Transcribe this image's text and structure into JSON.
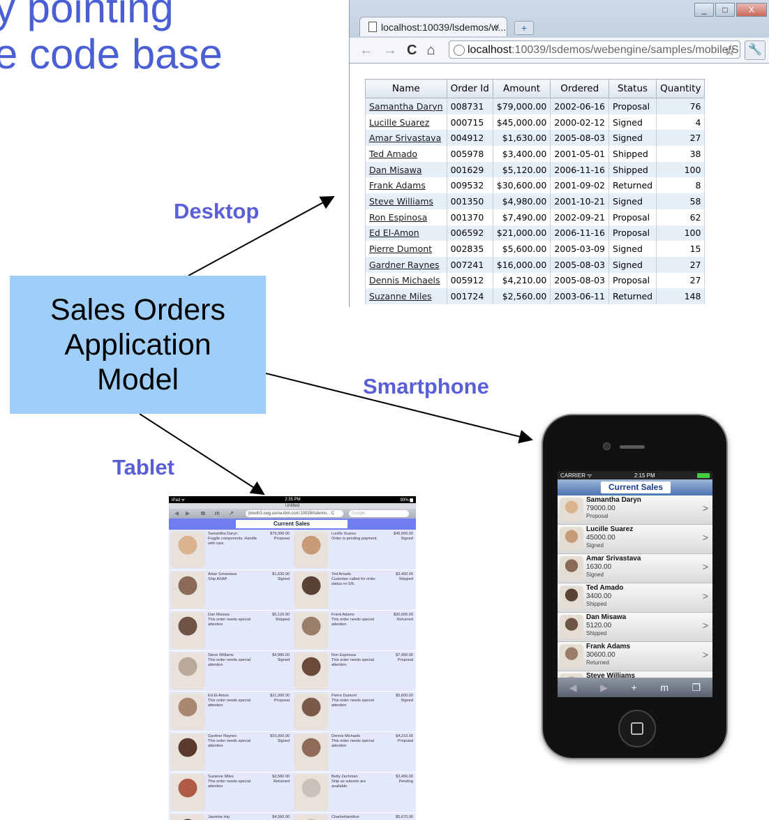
{
  "slide": {
    "title_lines": [
      "y pointing",
      "e code base"
    ],
    "center_box_lines": [
      "Sales Orders",
      "Application",
      "Model"
    ],
    "labels": {
      "desktop": "Desktop",
      "smartphone": "Smartphone",
      "tablet": "Tablet"
    }
  },
  "desktop_browser": {
    "tab_title": "localhost:10039/lsdemos/w...",
    "tab_close": "×",
    "new_tab": "+",
    "window_buttons": [
      "_",
      "□",
      "X"
    ],
    "nav": {
      "back": "←",
      "forward": "→",
      "reload": "C",
      "home": "⌂"
    },
    "url_host": "localhost",
    "url_rest": ":10039/lsdemos/webengine/samples/mobile/S:",
    "star": "☆",
    "wrench": "🔧",
    "table": {
      "columns": [
        "Name",
        "Order Id",
        "Amount",
        "Ordered",
        "Status",
        "Quantity"
      ],
      "rows": [
        [
          "Samantha Daryn",
          "008731",
          "$79,000.00",
          "2002-06-16",
          "Proposal",
          "76"
        ],
        [
          "Lucille Suarez",
          "000715",
          "$45,000.00",
          "2000-02-12",
          "Signed",
          "4"
        ],
        [
          "Amar Srivastava",
          "004912",
          "$1,630.00",
          "2005-08-03",
          "Signed",
          "27"
        ],
        [
          "Ted Amado",
          "005978",
          "$3,400.00",
          "2001-05-01",
          "Shipped",
          "38"
        ],
        [
          "Dan Misawa",
          "001629",
          "$5,120.00",
          "2006-11-16",
          "Shipped",
          "100"
        ],
        [
          "Frank Adams",
          "009532",
          "$30,600.00",
          "2001-09-02",
          "Returned",
          "8"
        ],
        [
          "Steve Williams",
          "001350",
          "$4,980.00",
          "2001-10-21",
          "Signed",
          "58"
        ],
        [
          "Ron Espinosa",
          "001370",
          "$7,490.00",
          "2002-09-21",
          "Proposal",
          "62"
        ],
        [
          "Ed El-Amon",
          "006592",
          "$21,000.00",
          "2006-11-16",
          "Proposal",
          "100"
        ],
        [
          "Pierre Dumont",
          "002835",
          "$5,600.00",
          "2005-03-09",
          "Signed",
          "15"
        ],
        [
          "Gardner Raynes",
          "007241",
          "$16,000.00",
          "2005-08-03",
          "Signed",
          "27"
        ],
        [
          "Dennis Michaels",
          "005912",
          "$4,210.00",
          "2005-08-03",
          "Proposal",
          "27"
        ],
        [
          "Suzanne Miles",
          "001724",
          "$2,560.00",
          "2003-06-11",
          "Returned",
          "148"
        ]
      ]
    }
  },
  "tablet": {
    "status_left": "iPad ᯤ",
    "status_time": "2:35 PM",
    "status_right": "93% ▆",
    "page_title": "Untitled",
    "url": "jbooth3.swg.usma.ibm.com:10039/lsdemo... C",
    "search_placeholder": "Google",
    "header": "Current Sales",
    "cards": [
      {
        "name": "Samantha Daryn",
        "note": "Fragile components. Handle with care.",
        "amount": "$79,000.00",
        "status": "Proposal",
        "color": "#d9b48f"
      },
      {
        "name": "Lucille Suarez",
        "note": "Order is pending payment.",
        "amount": "$45,000.00",
        "status": "Signed",
        "color": "#c99a78"
      },
      {
        "name": "Amar Srivastava",
        "note": "Ship ASAP.",
        "amount": "$1,630.00",
        "status": "Signed",
        "color": "#8a6a58"
      },
      {
        "name": "Ted Amado",
        "note": "Customer called for order status on 5/6.",
        "amount": "$3,400.00",
        "status": "Shipped",
        "color": "#5a4336"
      },
      {
        "name": "Dan Misawa",
        "note": "This order needs special attention",
        "amount": "$5,120.00",
        "status": "Shipped",
        "color": "#6e5546"
      },
      {
        "name": "Frank Adams",
        "note": "This order needs special attention",
        "amount": "$30,600.00",
        "status": "Returned",
        "color": "#9a7e6a"
      },
      {
        "name": "Steve Williams",
        "note": "This order needs special attention",
        "amount": "$4,980.00",
        "status": "Signed",
        "color": "#b9a99a"
      },
      {
        "name": "Ron Espinosa",
        "note": "This order needs special attention",
        "amount": "$7,490.00",
        "status": "Proposal",
        "color": "#6a4a38"
      },
      {
        "name": "Ed El-Amon",
        "note": "This order needs special attention",
        "amount": "$21,000.00",
        "status": "Proposal",
        "color": "#a98872"
      },
      {
        "name": "Pierre Dumont",
        "note": "This order needs special attention",
        "amount": "$5,600.00",
        "status": "Signed",
        "color": "#7a5a48"
      },
      {
        "name": "Gardner Raynes",
        "note": "This order needs special attention",
        "amount": "$16,000.00",
        "status": "Signed",
        "color": "#5a3a2c"
      },
      {
        "name": "Dennis Michaels",
        "note": "This order needs special attention",
        "amount": "$4,210.00",
        "status": "Proposal",
        "color": "#8e6c58"
      },
      {
        "name": "Suzanne Miles",
        "note": "This order needs special attention",
        "amount": "$2,560.00",
        "status": "Returned",
        "color": "#b05a48"
      },
      {
        "name": "Betty Zechman",
        "note": "Ship as subsets are available.",
        "amount": "$3,456.00",
        "status": "Pending",
        "color": "#c9c2b8"
      },
      {
        "name": "Jasmine Haj",
        "note": "",
        "amount": "$4,560.00",
        "status": "",
        "color": "#3a2a22"
      },
      {
        "name": "CharlieHamilton",
        "note": "",
        "amount": "$5,670.00",
        "status": "",
        "color": "#c8b8a8"
      }
    ]
  },
  "smartphone": {
    "carrier": "CARRIER ᯤ",
    "time": "2:15 PM",
    "header": "Current Sales",
    "chevron": ">",
    "rows": [
      {
        "name": "Samantha Daryn",
        "amount": "79000.00",
        "status": "Proposal",
        "color": "#d9b48f"
      },
      {
        "name": "Lucille Suarez",
        "amount": "45000.00",
        "status": "Signed",
        "color": "#c99a78"
      },
      {
        "name": "Amar Srivastava",
        "amount": "1630.00",
        "status": "Signed",
        "color": "#8a6a58"
      },
      {
        "name": "Ted Amado",
        "amount": "3400.00",
        "status": "Shipped",
        "color": "#5a4336"
      },
      {
        "name": "Dan Misawa",
        "amount": "5120.00",
        "status": "Shipped",
        "color": "#6e5546"
      },
      {
        "name": "Frank Adams",
        "amount": "30600.00",
        "status": "Returned",
        "color": "#9a7e6a"
      },
      {
        "name": "Steve Williams",
        "amount": "",
        "status": "",
        "color": "#b9a99a"
      }
    ],
    "bottom_bar": [
      "◀",
      "▶",
      "+",
      "m",
      "❐"
    ]
  }
}
